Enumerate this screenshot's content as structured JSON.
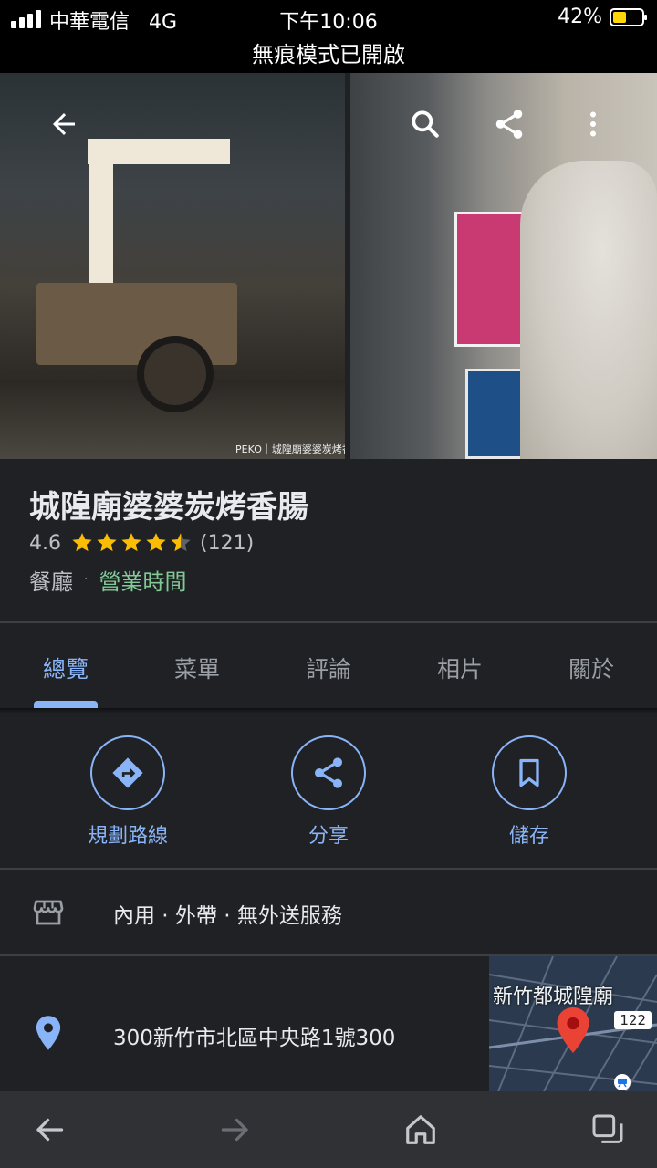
{
  "status_bar": {
    "carrier": "中華電信",
    "network": "4G",
    "time": "下午10:06",
    "battery": "42%",
    "battery_color": "#ffd60a",
    "incognito_text": "無痕模式已開啟"
  },
  "photos": {
    "left_credit": "PEKO｜城隍廟婆婆炭烤香",
    "icons": [
      "back-arrow-icon",
      "search-icon",
      "share-icon",
      "more-vert-icon"
    ]
  },
  "place": {
    "name": "城隍廟婆婆炭烤香腸",
    "rating": "4.6",
    "rating_stars": 4.6,
    "review_count": "(121)",
    "category": "餐廳",
    "separator": "·",
    "hours": "營業時間"
  },
  "tabs": [
    {
      "label": "總覽",
      "active": true
    },
    {
      "label": "菜單",
      "active": false
    },
    {
      "label": "評論",
      "active": false
    },
    {
      "label": "相片",
      "active": false
    },
    {
      "label": "關於",
      "active": false
    }
  ],
  "actions": [
    {
      "label": "規劃路線",
      "icon": "directions-icon"
    },
    {
      "label": "分享",
      "icon": "share-icon"
    },
    {
      "label": "儲存",
      "icon": "bookmark-icon"
    }
  ],
  "service": {
    "text": "內用 · 外帶 · 無外送服務",
    "icon": "storefront-icon"
  },
  "address": {
    "text": "300新竹市北區中央路1號300",
    "icon": "location-pin-icon",
    "map_label": "新竹都城隍廟",
    "road_number": "122"
  },
  "colors": {
    "accent": "#8ab4f8",
    "open_green": "#81c995",
    "star": "#fbbc04",
    "background": "#202124"
  }
}
